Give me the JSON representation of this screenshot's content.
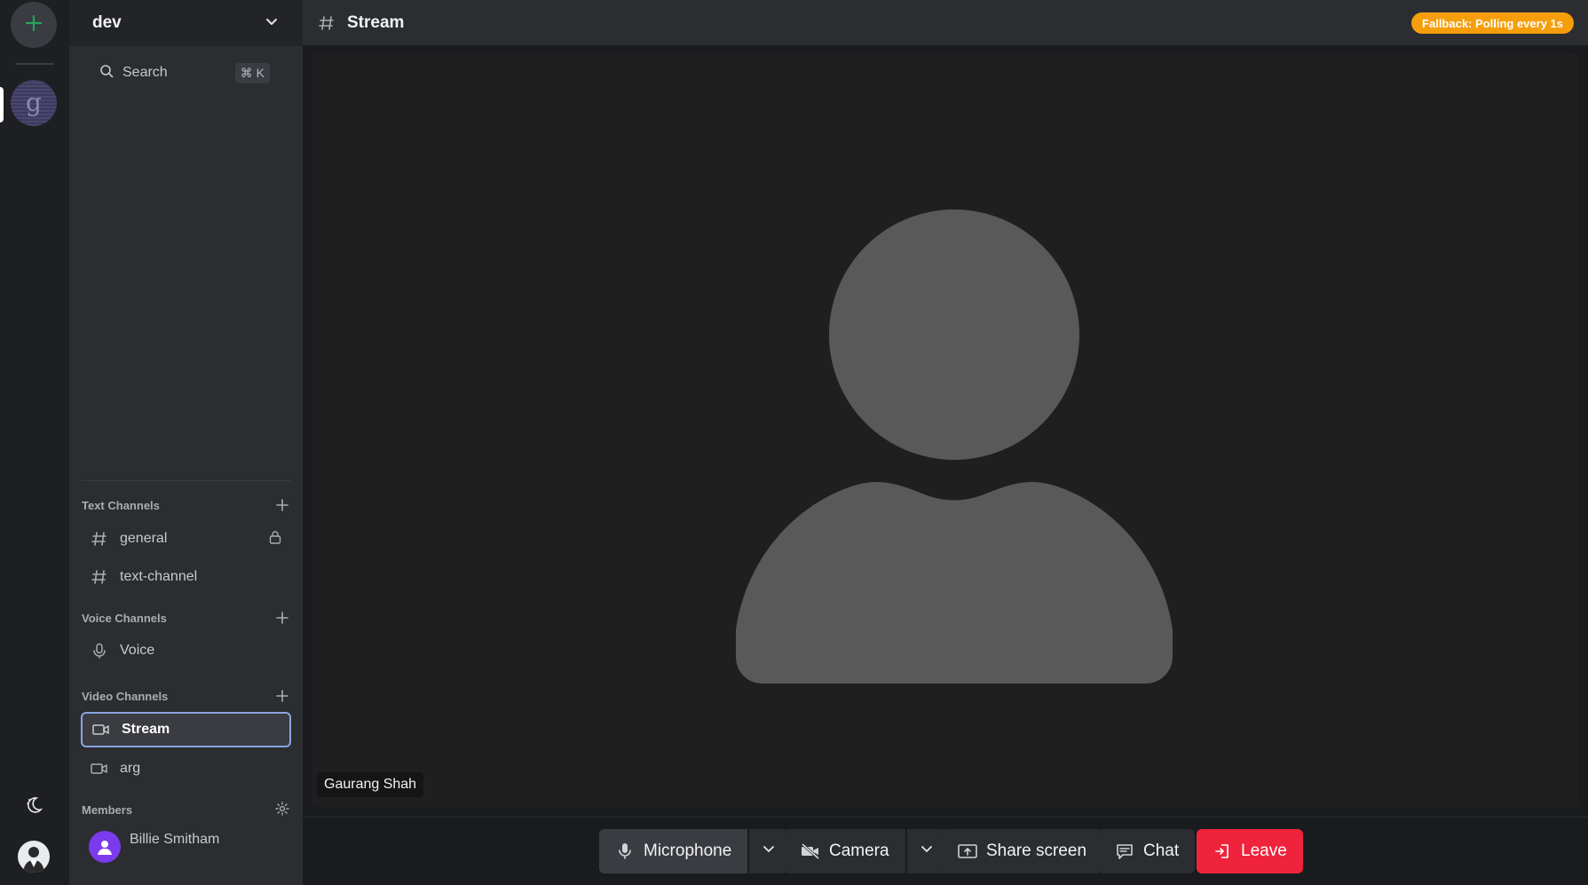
{
  "server": {
    "name": "dev"
  },
  "search": {
    "label": "Search",
    "shortcut": "⌘ K"
  },
  "sections": {
    "text": "Text Channels",
    "voice": "Voice Channels",
    "video": "Video Channels",
    "members": "Members"
  },
  "text_channels": [
    {
      "label": "general",
      "locked": true
    },
    {
      "label": "text-channel"
    }
  ],
  "voice_channels": [
    {
      "label": "Voice"
    }
  ],
  "video_channels": [
    {
      "label": "Stream",
      "active": true
    },
    {
      "label": "arg"
    }
  ],
  "members": [
    {
      "name": "Billie Smitham"
    }
  ],
  "topbar": {
    "title": "Stream",
    "status_badge": "Fallback: Polling every 1s"
  },
  "video": {
    "participant_name": "Gaurang Shah"
  },
  "controls": {
    "microphone": "Microphone",
    "camera": "Camera",
    "share_screen": "Share screen",
    "chat": "Chat",
    "leave": "Leave"
  },
  "colors": {
    "accent_green": "#23a55a",
    "badge_orange": "#f59e0b",
    "leave_red": "#ef233c",
    "active_border": "#8aa4e0"
  }
}
